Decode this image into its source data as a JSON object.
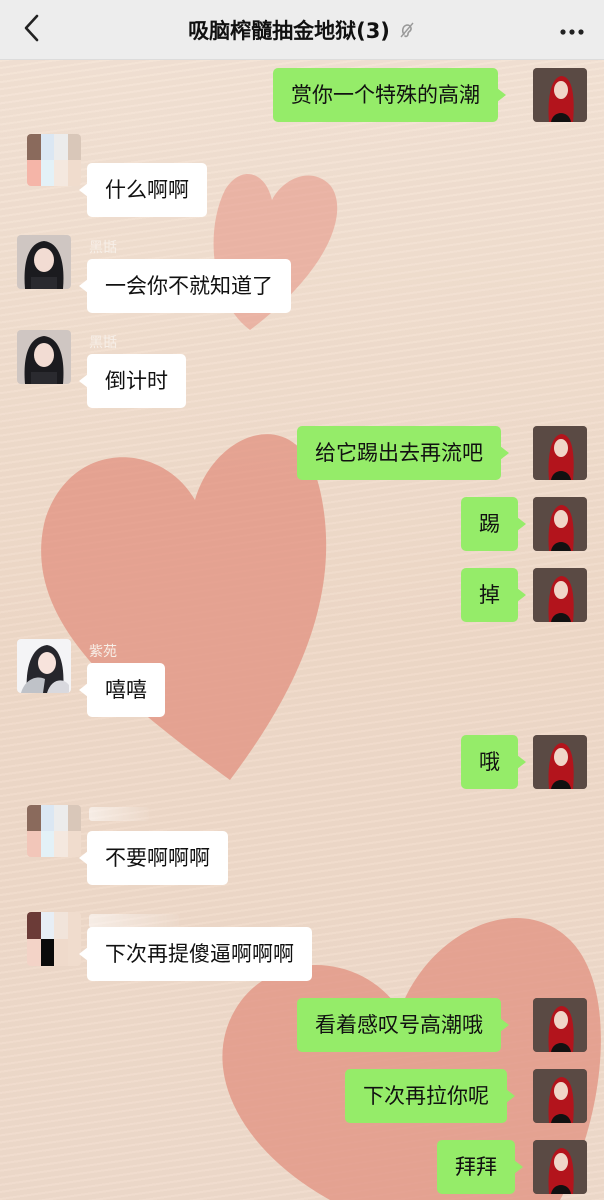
{
  "header": {
    "title": "吸脑榨髓抽金地狱(3)",
    "back_icon": "chevron-left-icon",
    "mute_icon": "ear-mute-icon",
    "more_icon": "more-dots-icon"
  },
  "colors": {
    "header_bg": "#ededed",
    "my_bubble": "#95ec69",
    "other_bubble": "#ffffff",
    "chat_bg": "#f0dccd",
    "heart": "#e7998a"
  },
  "messages": [
    {
      "side": "me",
      "text": "赏你一个特殊的高潮"
    },
    {
      "side": "other",
      "sender": "",
      "text": "什么啊啊"
    },
    {
      "side": "other",
      "sender": "黑甛",
      "text": "一会你不就知道了"
    },
    {
      "side": "other",
      "sender": "黑甛",
      "text": "倒计时"
    },
    {
      "side": "me",
      "text": "给它踢出去再流吧"
    },
    {
      "side": "me",
      "text": "踢"
    },
    {
      "side": "me",
      "text": "掉"
    },
    {
      "side": "other",
      "sender": "紫苑",
      "text": "嘻嘻"
    },
    {
      "side": "me",
      "text": "哦"
    },
    {
      "side": "other",
      "sender": "",
      "text": "不要啊啊啊"
    },
    {
      "side": "other",
      "sender": "",
      "text": "下次再提傻逼啊啊啊"
    },
    {
      "side": "me",
      "text": "看着感叹号高潮哦"
    },
    {
      "side": "me",
      "text": "下次再拉你呢"
    },
    {
      "side": "me",
      "text": "拜拜"
    }
  ]
}
